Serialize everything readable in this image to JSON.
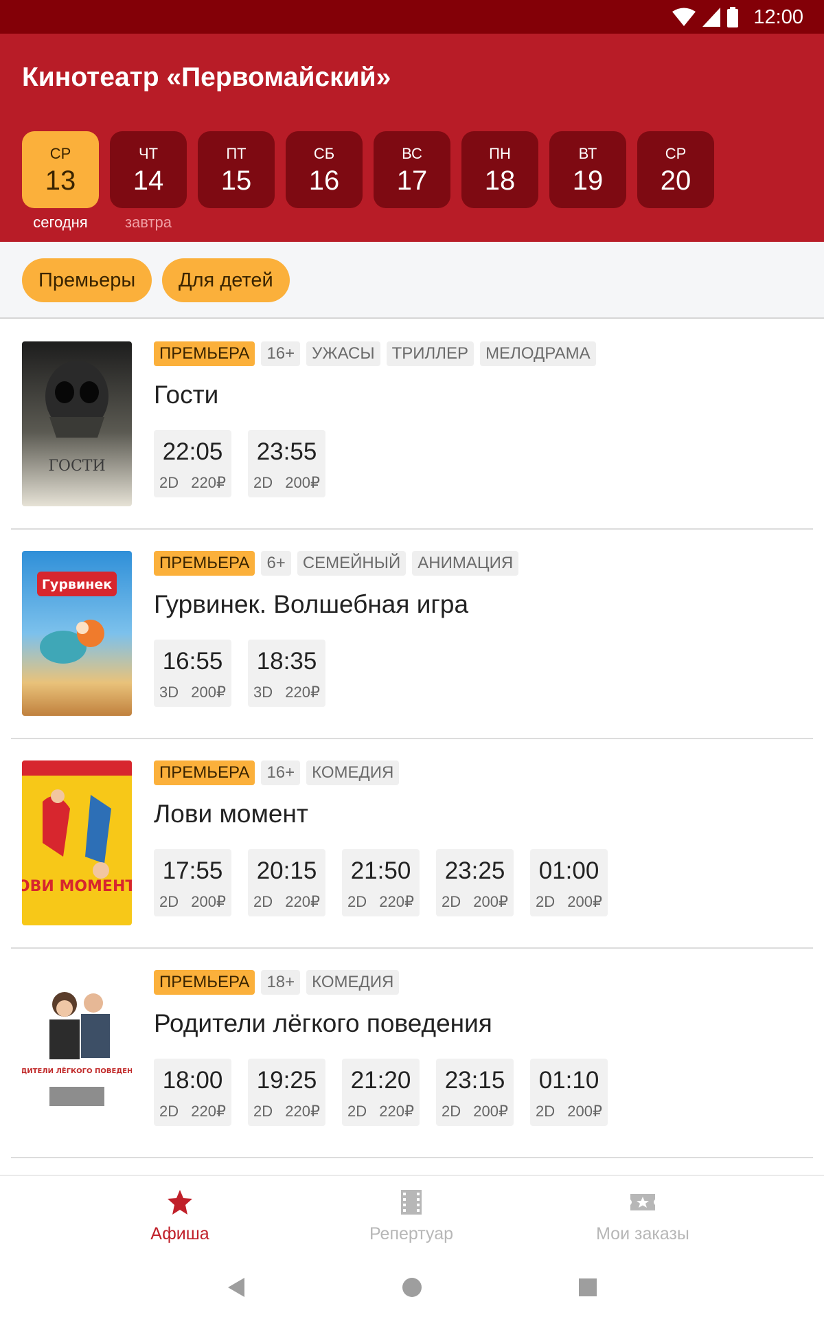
{
  "status_bar": {
    "time": "12:00"
  },
  "header": {
    "title": "Кинотеатр «Первомайский»"
  },
  "days": [
    {
      "name": "СР",
      "num": "13",
      "sub": "сегодня",
      "active": true
    },
    {
      "name": "ЧТ",
      "num": "14",
      "sub": "завтра"
    },
    {
      "name": "ПТ",
      "num": "15"
    },
    {
      "name": "СБ",
      "num": "16"
    },
    {
      "name": "ВС",
      "num": "17"
    },
    {
      "name": "ПН",
      "num": "18"
    },
    {
      "name": "ВТ",
      "num": "19"
    },
    {
      "name": "СР",
      "num": "20"
    }
  ],
  "filters": [
    "Премьеры",
    "Для детей"
  ],
  "movies": [
    {
      "tags": [
        "ПРЕМЬЕРА",
        "16+",
        "УЖАСЫ",
        "ТРИЛЛЕР",
        "МЕЛОДРАМА"
      ],
      "title": "Гости",
      "poster_text": "ГОСТИ",
      "shows": [
        {
          "time": "22:05",
          "format": "2D",
          "price": "220₽"
        },
        {
          "time": "23:55",
          "format": "2D",
          "price": "200₽"
        }
      ]
    },
    {
      "tags": [
        "ПРЕМЬЕРА",
        "6+",
        "СЕМЕЙНЫЙ",
        "АНИМАЦИЯ"
      ],
      "title": "Гурвинек. Волшебная игра",
      "poster_text": "Гурвинек",
      "shows": [
        {
          "time": "16:55",
          "format": "3D",
          "price": "200₽"
        },
        {
          "time": "18:35",
          "format": "3D",
          "price": "220₽"
        }
      ]
    },
    {
      "tags": [
        "ПРЕМЬЕРА",
        "16+",
        "КОМЕДИЯ"
      ],
      "title": "Лови момент",
      "poster_text": "ЛОВИ МОМЕНТ",
      "shows": [
        {
          "time": "17:55",
          "format": "2D",
          "price": "200₽"
        },
        {
          "time": "20:15",
          "format": "2D",
          "price": "220₽"
        },
        {
          "time": "21:50",
          "format": "2D",
          "price": "220₽"
        },
        {
          "time": "23:25",
          "format": "2D",
          "price": "200₽"
        },
        {
          "time": "01:00",
          "format": "2D",
          "price": "200₽"
        }
      ]
    },
    {
      "tags": [
        "ПРЕМЬЕРА",
        "18+",
        "КОМЕДИЯ"
      ],
      "title": "Родители лёгкого поведения",
      "poster_text": "РОДИТЕЛИ ЛЁГКОГО ПОВЕДЕНИЯ",
      "shows": [
        {
          "time": "18:00",
          "format": "2D",
          "price": "220₽"
        },
        {
          "time": "19:25",
          "format": "2D",
          "price": "220₽"
        },
        {
          "time": "21:20",
          "format": "2D",
          "price": "220₽"
        },
        {
          "time": "23:15",
          "format": "2D",
          "price": "200₽"
        },
        {
          "time": "01:10",
          "format": "2D",
          "price": "200₽"
        }
      ]
    }
  ],
  "bottom_nav": [
    {
      "label": "Афиша",
      "icon": "star-icon",
      "active": true
    },
    {
      "label": "Репертуар",
      "icon": "film-icon"
    },
    {
      "label": "Мои заказы",
      "icon": "ticket-icon"
    }
  ],
  "colors": {
    "header": "#b81c27",
    "status_bar": "#830007",
    "accent": "#fbb03b",
    "active_nav": "#c0202a"
  }
}
